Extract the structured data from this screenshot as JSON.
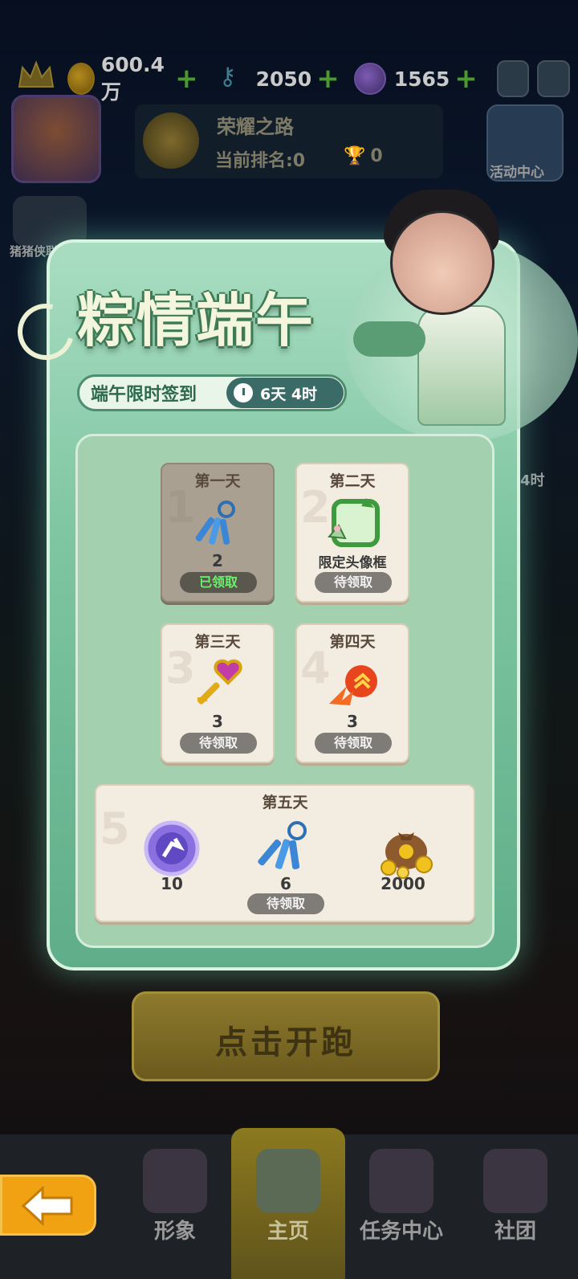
{
  "resources": {
    "coins": "600.4万",
    "keys": "2050",
    "gems": "1565"
  },
  "hud": {
    "rank_title": "荣耀之路",
    "rank_current": "当前排名:0",
    "trophy_count": "0",
    "activity_center": "活动中心",
    "pig_hero_link": "猪猪侠联动",
    "side_timer": "4时"
  },
  "event": {
    "title": "粽情端午",
    "subtitle": "端午限时签到",
    "timer": "6天 4时"
  },
  "days": [
    {
      "label": "第一天",
      "num": "1",
      "item_icon": "keys-icon",
      "value": "2",
      "status": "已领取",
      "claimed": true
    },
    {
      "label": "第二天",
      "num": "2",
      "item_icon": "avatar-frame-icon",
      "value": "限定头像框",
      "status": "待领取",
      "claimed": false
    },
    {
      "label": "第三天",
      "num": "3",
      "item_icon": "heart-key-icon",
      "value": "3",
      "status": "待领取",
      "claimed": false
    },
    {
      "label": "第四天",
      "num": "4",
      "item_icon": "fire-boost-icon",
      "value": "3",
      "status": "待领取",
      "claimed": false
    }
  ],
  "day5": {
    "label": "第五天",
    "num": "5",
    "rewards": [
      {
        "icon": "runner-token-icon",
        "value": "10"
      },
      {
        "icon": "keys-icon",
        "value": "6"
      },
      {
        "icon": "coin-bag-icon",
        "value": "2000"
      }
    ],
    "status": "待领取"
  },
  "run_button": "点击开跑",
  "nav": {
    "character": "形象",
    "home": "主页",
    "tasks": "任务中心",
    "club": "社团"
  },
  "colors": {
    "panel_green": "#7fc6a2",
    "claimed_text": "#6df06d",
    "back_button": "#f1a213"
  }
}
